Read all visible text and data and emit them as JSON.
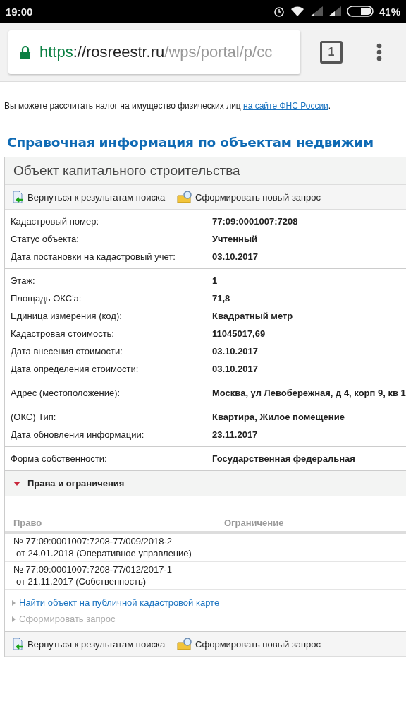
{
  "status_bar": {
    "time": "19:00",
    "battery": "41%"
  },
  "browser": {
    "url_scheme": "https",
    "url_host": "://rosreestr.ru",
    "url_path": "/wps/portal/p/cc",
    "tab_count": "1"
  },
  "notice": {
    "text": "Вы можете рассчитать налог на имущество физических лиц ",
    "link": "на сайте ФНС России",
    "end": "."
  },
  "title": "Справочная информация по объектам недвижим",
  "panel": {
    "title": "Объект капитального строительства",
    "toolbar": [
      "Вернуться к результатам поиска",
      "Сформировать новый запрос"
    ],
    "sections": [
      [
        {
          "label": "Кадастровый номер:",
          "value": "77:09:0001007:7208"
        },
        {
          "label": "Статус объекта:",
          "value": "Учтенный"
        },
        {
          "label": "Дата постановки на кадастровый учет:",
          "value": "03.10.2017"
        }
      ],
      [
        {
          "label": "Этаж:",
          "value": "1"
        },
        {
          "label": "Площадь ОКС'a:",
          "value": "71,8"
        },
        {
          "label": "Единица измерения (код):",
          "value": "Квадратный метр"
        },
        {
          "label": "Кадастровая стоимость:",
          "value": "11045017,69"
        },
        {
          "label": "Дата внесения стоимости:",
          "value": "03.10.2017"
        },
        {
          "label": "Дата определения стоимости:",
          "value": "03.10.2017"
        }
      ],
      [
        {
          "label": "Адрес (местоположение):",
          "value": "Москва, ул Левобережная, д 4, корп 9, кв 1"
        }
      ],
      [
        {
          "label": "(ОКС) Тип:",
          "value": "Квартира, Жилое помещение"
        },
        {
          "label": "Дата обновления информации:",
          "value": "23.11.2017"
        }
      ],
      [
        {
          "label": "Форма собственности:",
          "value": "Государственная федеральная"
        }
      ]
    ],
    "rights": {
      "title": "Права и ограничения",
      "expanded": true,
      "columns": [
        "Право",
        "Ограничение"
      ],
      "rows": [
        {
          "right": [
            "№ 77:09:0001007:7208-77/009/2018-2",
            "от 24.01.2018  (Оперативное управление)"
          ]
        },
        {
          "right": [
            "№ 77:09:0001007:7208-77/012/2017-1",
            "от 21.11.2017  (Собственность)"
          ]
        }
      ]
    },
    "links": [
      {
        "text": "Найти объект на публичной кадастровой карте",
        "disabled": false
      },
      {
        "text": "Сформировать запрос",
        "disabled": true
      }
    ],
    "bottom_toolbar": [
      "Вернуться к результатам поиска",
      "Сформировать новый запрос"
    ]
  }
}
